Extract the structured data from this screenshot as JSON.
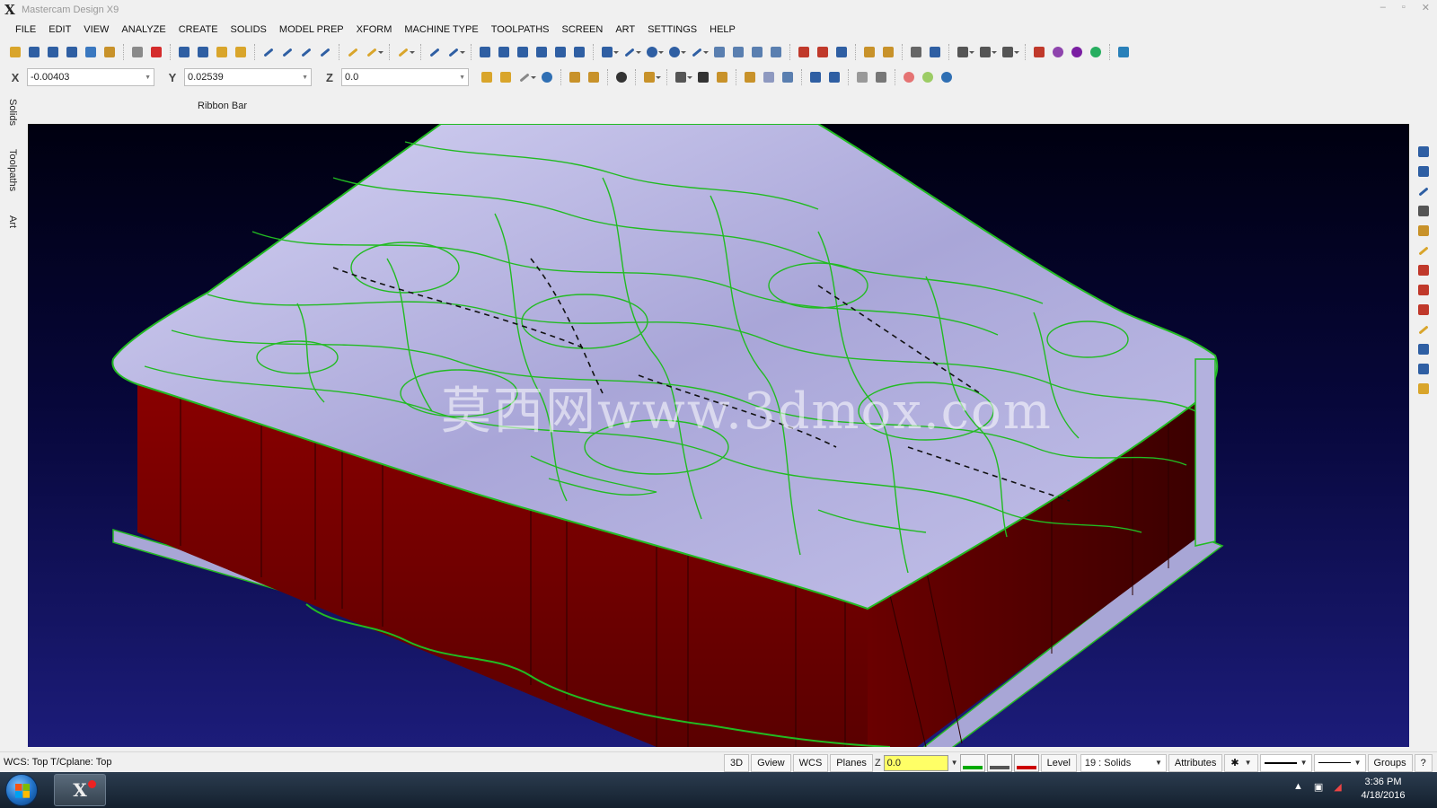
{
  "window": {
    "title": "Mastercam Design X9",
    "logo": "X",
    "controls": [
      "–",
      "▫",
      "✕"
    ]
  },
  "menu": [
    "FILE",
    "EDIT",
    "VIEW",
    "ANALYZE",
    "CREATE",
    "SOLIDS",
    "MODEL PREP",
    "XFORM",
    "MACHINE TYPE",
    "TOOLPATHS",
    "SCREEN",
    "ART",
    "SETTINGS",
    "HELP"
  ],
  "coords": {
    "x_label": "X",
    "x_value": "-0.00403",
    "y_label": "Y",
    "y_value": "0.02539",
    "z_label": "Z",
    "z_value": "0.0"
  },
  "ribbon_label": "Ribbon Bar",
  "left_tabs": [
    "Solids",
    "Toolpaths",
    "Art"
  ],
  "watermark": "莫西网www.3dmox.com",
  "status": {
    "left_text": "WCS: Top  T/Cplane: Top",
    "btn_3d": "3D",
    "btn_gview": "Gview",
    "btn_wcs": "WCS",
    "btn_planes": "Planes",
    "z_label": "Z",
    "z_value": "0.0",
    "level_label": "Level",
    "level_value": "19 : Solids",
    "attributes": "Attributes",
    "point_style": "✱",
    "groups": "Groups",
    "help": "?"
  },
  "colors": {
    "solid_top": "#b0aedd",
    "solid_side": "#7a0000",
    "wire": "#22bb22",
    "bg_top": "#000010",
    "bg_bottom": "#1c1c7a"
  },
  "taskbar": {
    "app_label": "X",
    "time": "3:36 PM",
    "date": "4/18/2016"
  }
}
